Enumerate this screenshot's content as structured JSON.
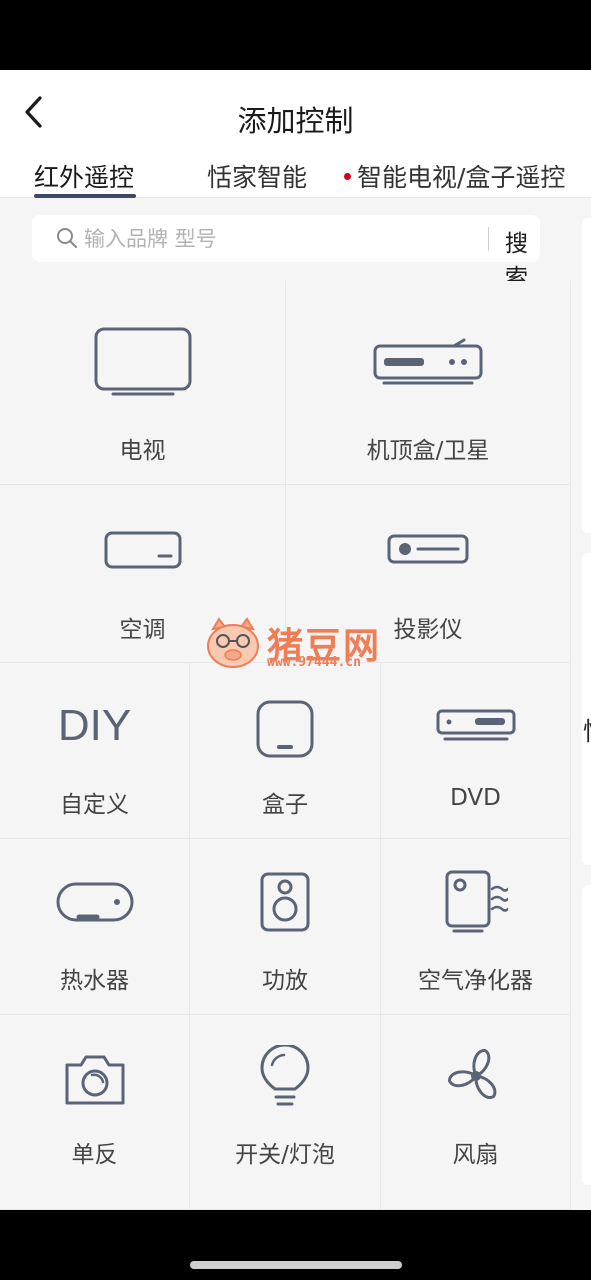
{
  "header": {
    "title": "添加控制"
  },
  "tabs": [
    {
      "label": "红外遥控",
      "active": true
    },
    {
      "label": "恬家智能",
      "active": false
    },
    {
      "label": "智能电视/盒子遥控",
      "active": false
    }
  ],
  "search": {
    "placeholder": "输入品牌 型号",
    "button_label": "搜索"
  },
  "devices": [
    {
      "label": "电视",
      "icon": "tv-icon"
    },
    {
      "label": "机顶盒/卫星",
      "icon": "set-top-box-icon"
    },
    {
      "label": "空调",
      "icon": "air-conditioner-icon"
    },
    {
      "label": "投影仪",
      "icon": "projector-icon"
    },
    {
      "label": "DIY",
      "icon": "diy-icon"
    },
    {
      "label": "自定义",
      "icon": ""
    },
    {
      "label": "盒子",
      "icon": "box-icon"
    },
    {
      "label": "DVD",
      "icon": "dvd-icon"
    },
    {
      "label": "热水器",
      "icon": "water-heater-icon"
    },
    {
      "label": "功放",
      "icon": "speaker-icon"
    },
    {
      "label": "空气净化器",
      "icon": "air-purifier-icon"
    },
    {
      "label": "单反",
      "icon": "camera-icon"
    },
    {
      "label": "开关/灯泡",
      "icon": "bulb-icon"
    },
    {
      "label": "风扇",
      "icon": "fan-icon"
    }
  ],
  "side_peek": {
    "glyph": "恬"
  },
  "watermark": {
    "name": "猪豆网",
    "url": "www.97444.cn"
  },
  "colors": {
    "icon_stroke": "#5b6475",
    "accent_dot": "#d0021b",
    "watermark": "#ef7d55"
  }
}
